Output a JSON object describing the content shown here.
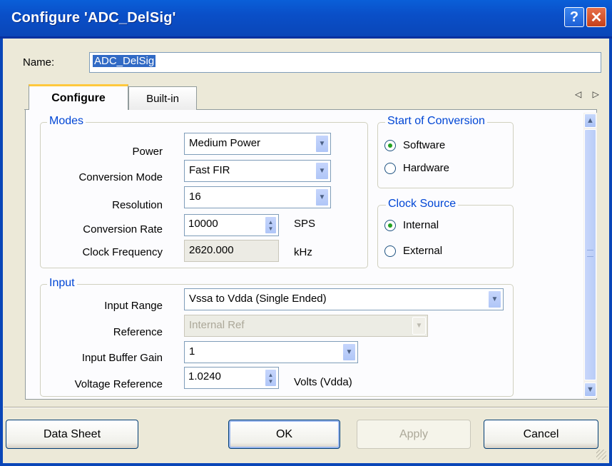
{
  "window": {
    "title": "Configure 'ADC_DelSig'",
    "help_glyph": "?",
    "close_glyph": "✕"
  },
  "name_field": {
    "label": "Name:",
    "value": "ADC_DelSig"
  },
  "tabs": [
    {
      "label": "Configure",
      "selected": true
    },
    {
      "label": "Built-in",
      "selected": false
    }
  ],
  "tab_scroll_arrows": "◁ ▷",
  "modes": {
    "title": "Modes",
    "power": {
      "label": "Power",
      "value": "Medium Power"
    },
    "conversion_mode": {
      "label": "Conversion Mode",
      "value": "Fast FIR"
    },
    "resolution": {
      "label": "Resolution",
      "value": "16"
    },
    "conversion_rate": {
      "label": "Conversion Rate",
      "value": "10000",
      "unit": "SPS"
    },
    "clock_frequency": {
      "label": "Clock Frequency",
      "value": "2620.000",
      "unit": "kHz"
    }
  },
  "start_of_conversion": {
    "title": "Start of Conversion",
    "options": [
      {
        "label": "Software",
        "selected": true
      },
      {
        "label": "Hardware",
        "selected": false
      }
    ]
  },
  "clock_source": {
    "title": "Clock Source",
    "options": [
      {
        "label": "Internal",
        "selected": true
      },
      {
        "label": "External",
        "selected": false
      }
    ]
  },
  "input": {
    "title": "Input",
    "input_range": {
      "label": "Input Range",
      "value": "Vssa to Vdda (Single Ended)"
    },
    "reference": {
      "label": "Reference",
      "value": "Internal Ref"
    },
    "input_buffer_gain": {
      "label": "Input Buffer Gain",
      "value": "1"
    },
    "voltage_reference": {
      "label": "Voltage Reference",
      "value": "1.0240",
      "unit": "Volts (Vdda)"
    }
  },
  "buttons": {
    "data_sheet": "Data Sheet",
    "ok": "OK",
    "apply": "Apply",
    "cancel": "Cancel"
  },
  "colors": {
    "titlebar": "#0a4fc8",
    "legend_text": "#0046d5",
    "radio_dot": "#21a121",
    "selection": "#316ac5"
  }
}
